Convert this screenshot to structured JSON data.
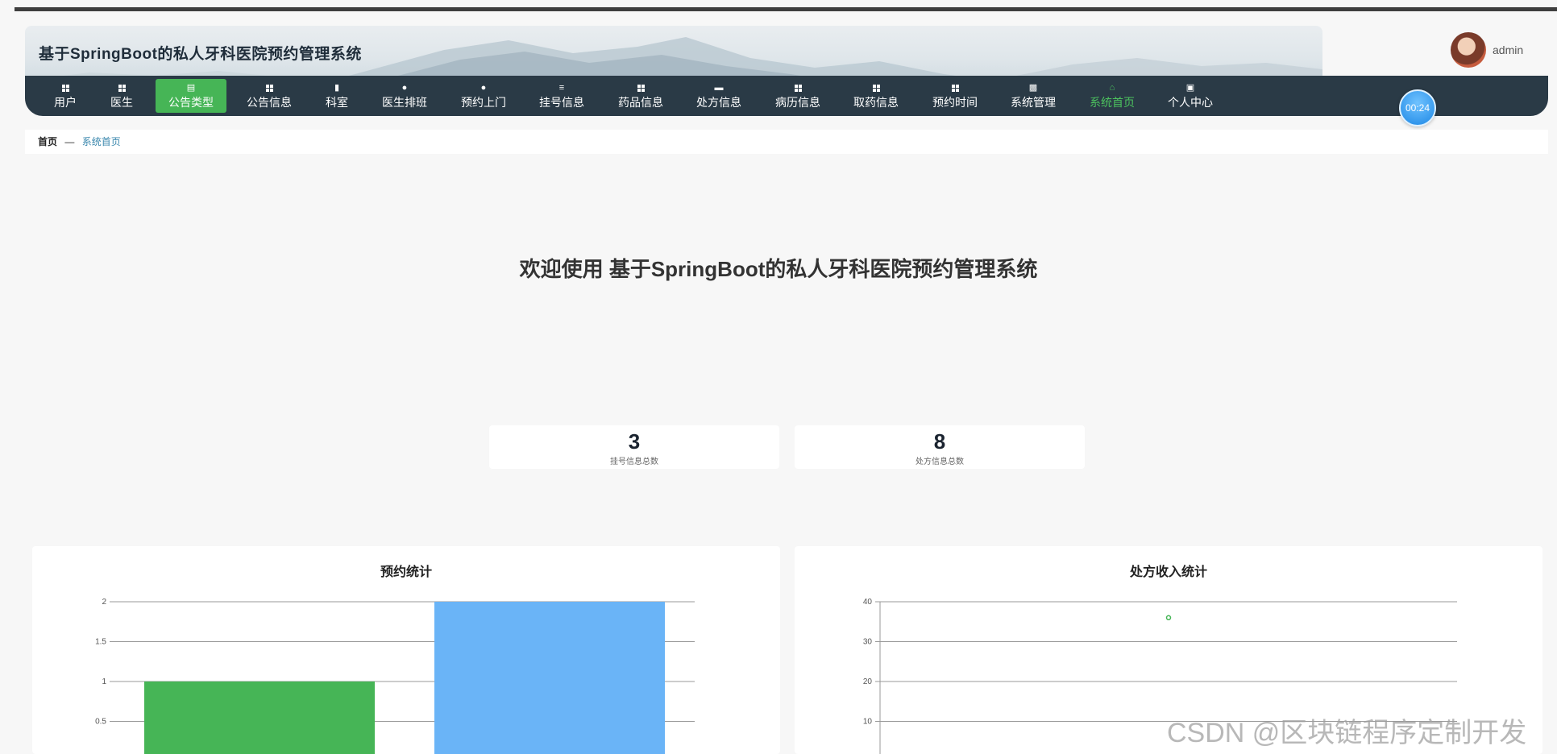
{
  "app": {
    "title": "基于SpringBoot的私人牙科医院预约管理系统",
    "user_name": "admin",
    "timer": "00:24"
  },
  "nav": [
    {
      "label": "用户",
      "icon": "grid-icon"
    },
    {
      "label": "医生",
      "icon": "grid-icon"
    },
    {
      "label": "公告类型",
      "icon": "clipboard-icon",
      "active": true
    },
    {
      "label": "公告信息",
      "icon": "grid-icon"
    },
    {
      "label": "科室",
      "icon": "chat-icon"
    },
    {
      "label": "医生排班",
      "icon": "user-badge-icon"
    },
    {
      "label": "预约上门",
      "icon": "user-icon"
    },
    {
      "label": "挂号信息",
      "icon": "list-icon"
    },
    {
      "label": "药品信息",
      "icon": "grid-icon"
    },
    {
      "label": "处方信息",
      "icon": "briefcase-icon"
    },
    {
      "label": "病历信息",
      "icon": "grid-icon"
    },
    {
      "label": "取药信息",
      "icon": "grid-icon"
    },
    {
      "label": "预约时间",
      "icon": "grid-icon"
    },
    {
      "label": "系统管理",
      "icon": "bar-chart-icon"
    },
    {
      "label": "系统首页",
      "icon": "home-icon",
      "current": true
    },
    {
      "label": "个人中心",
      "icon": "window-icon"
    }
  ],
  "breadcrumb": {
    "home": "首页",
    "sep": "—",
    "current": "系统首页"
  },
  "welcome": "欢迎使用 基于SpringBoot的私人牙科医院预约管理系统",
  "stats": [
    {
      "value": "3",
      "label": "挂号信息总数"
    },
    {
      "value": "8",
      "label": "处方信息总数"
    }
  ],
  "colors": {
    "nav_bg": "#2a3a46",
    "active": "#46b556",
    "bar_green": "#46b556",
    "bar_blue": "#6ab4f7"
  },
  "watermark": "CSDN @区块链程序定制开发",
  "chart_data": [
    {
      "type": "bar",
      "title": "预约统计",
      "categories": [
        "",
        ""
      ],
      "values": [
        1,
        2
      ],
      "colors": [
        "#46b556",
        "#6ab4f7"
      ],
      "ylim": [
        0,
        2
      ],
      "yticks": [
        "2",
        "1.5",
        "1",
        "0.5"
      ],
      "ytick_values": [
        2,
        1.5,
        1,
        0.5
      ],
      "grid": true
    },
    {
      "type": "scatter",
      "title": "处方收入统计",
      "points": [
        {
          "x": 0.5,
          "y": 36
        }
      ],
      "ylim": [
        0,
        40
      ],
      "yticks": [
        "40",
        "30",
        "20",
        "10"
      ],
      "ytick_values": [
        40,
        30,
        20,
        10
      ],
      "grid": true
    }
  ]
}
